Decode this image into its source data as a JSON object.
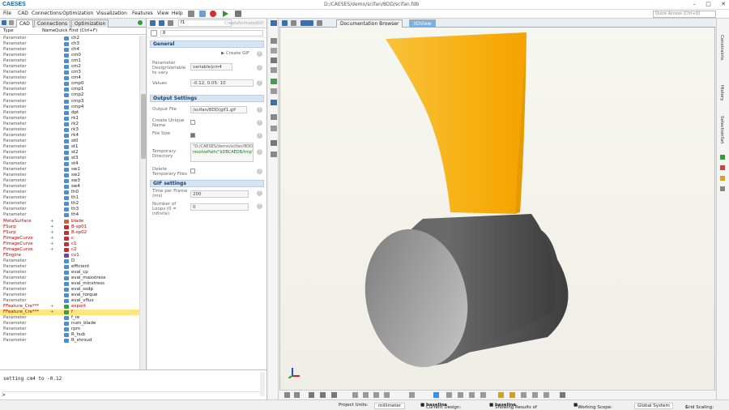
{
  "window": {
    "logo": "CAESES",
    "title": "D:/CAESES/demo/scifan/8DD/scifan.fdb",
    "controls": [
      "–",
      "□",
      "✕"
    ]
  },
  "menu": [
    "File",
    "CAD",
    "Connections",
    "Optimization",
    "Visualization",
    "Features",
    "View",
    "Help"
  ],
  "search_placeholder": "Quick Access (Ctrl+Q)",
  "left_tabs": [
    "CAD",
    "Connections",
    "Optimization"
  ],
  "tree_headers": [
    "Type",
    "Name",
    "Quick Find (Ctrl+F)"
  ],
  "tree": [
    {
      "t": "Parameter",
      "n": "ch2",
      "c": "#4a8fd6"
    },
    {
      "t": "Parameter",
      "n": "ch3",
      "c": "#4a8fd6"
    },
    {
      "t": "Parameter",
      "n": "ch4",
      "c": "#4a8fd6"
    },
    {
      "t": "Parameter",
      "n": "cm0",
      "c": "#4a8fd6"
    },
    {
      "t": "Parameter",
      "n": "cm1",
      "c": "#4a8fd6"
    },
    {
      "t": "Parameter",
      "n": "cm2",
      "c": "#4a8fd6"
    },
    {
      "t": "Parameter",
      "n": "cm3",
      "c": "#4a8fd6"
    },
    {
      "t": "Parameter",
      "n": "cm4",
      "c": "#4a8fd6"
    },
    {
      "t": "Parameter",
      "n": "cmp0",
      "c": "#4a8fd6"
    },
    {
      "t": "Parameter",
      "n": "cmp1",
      "c": "#4a8fd6"
    },
    {
      "t": "Parameter",
      "n": "cmp2",
      "c": "#4a8fd6"
    },
    {
      "t": "Parameter",
      "n": "cmp3",
      "c": "#4a8fd6"
    },
    {
      "t": "Parameter",
      "n": "cmp4",
      "c": "#4a8fd6"
    },
    {
      "t": "Parameter",
      "n": "dpt",
      "c": "#4a8fd6"
    },
    {
      "t": "Parameter",
      "n": "rk1",
      "c": "#4a8fd6"
    },
    {
      "t": "Parameter",
      "n": "rk2",
      "c": "#4a8fd6"
    },
    {
      "t": "Parameter",
      "n": "rk3",
      "c": "#4a8fd6"
    },
    {
      "t": "Parameter",
      "n": "rk4",
      "c": "#4a8fd6"
    },
    {
      "t": "Parameter",
      "n": "st0",
      "c": "#4a8fd6"
    },
    {
      "t": "Parameter",
      "n": "st1",
      "c": "#4a8fd6"
    },
    {
      "t": "Parameter",
      "n": "st2",
      "c": "#4a8fd6"
    },
    {
      "t": "Parameter",
      "n": "st3",
      "c": "#4a8fd6"
    },
    {
      "t": "Parameter",
      "n": "st4",
      "c": "#4a8fd6"
    },
    {
      "t": "Parameter",
      "n": "sw1",
      "c": "#4a8fd6"
    },
    {
      "t": "Parameter",
      "n": "sw2",
      "c": "#4a8fd6"
    },
    {
      "t": "Parameter",
      "n": "sw3",
      "c": "#4a8fd6"
    },
    {
      "t": "Parameter",
      "n": "sw4",
      "c": "#4a8fd6"
    },
    {
      "t": "Parameter",
      "n": "th0",
      "c": "#4a8fd6"
    },
    {
      "t": "Parameter",
      "n": "th1",
      "c": "#4a8fd6"
    },
    {
      "t": "Parameter",
      "n": "th2",
      "c": "#4a8fd6"
    },
    {
      "t": "Parameter",
      "n": "th3",
      "c": "#4a8fd6"
    },
    {
      "t": "Parameter",
      "n": "th4",
      "c": "#4a8fd6"
    },
    {
      "t": "MetaSurface",
      "n": "blade",
      "c": "#d06030",
      "red": true,
      "exp": "+"
    },
    {
      "t": "FSurp",
      "n": "B-sp01",
      "c": "#c03030",
      "red": true,
      "exp": "+"
    },
    {
      "t": "FSurp",
      "n": "B-sp02",
      "c": "#c03030",
      "red": true,
      "exp": "+"
    },
    {
      "t": "FImageCurve",
      "n": "c",
      "c": "#c03030",
      "red": true,
      "exp": "+"
    },
    {
      "t": "FImageCurve",
      "n": "c1",
      "c": "#c03030",
      "red": true,
      "exp": "+"
    },
    {
      "t": "FImageCurve",
      "n": "c2",
      "c": "#c03030",
      "red": true,
      "exp": "+"
    },
    {
      "t": "FEngine",
      "n": "cv1",
      "c": "#8040a0",
      "red": true
    },
    {
      "t": "Parameter",
      "n": "D",
      "c": "#4a8fd6"
    },
    {
      "t": "Parameter",
      "n": "efficient",
      "c": "#4a8fd6"
    },
    {
      "t": "Parameter",
      "n": "eval_cp",
      "c": "#4a8fd6"
    },
    {
      "t": "Parameter",
      "n": "eval_maxstress",
      "c": "#4a8fd6"
    },
    {
      "t": "Parameter",
      "n": "eval_minstress",
      "c": "#4a8fd6"
    },
    {
      "t": "Parameter",
      "n": "eval_ssdp",
      "c": "#4a8fd6"
    },
    {
      "t": "Parameter",
      "n": "eval_torque",
      "c": "#4a8fd6"
    },
    {
      "t": "Parameter",
      "n": "eval_vflux",
      "c": "#4a8fd6"
    },
    {
      "t": "FFeature_Cre***",
      "n": "export",
      "c": "#30a050",
      "red": true,
      "exp": "+"
    },
    {
      "t": "FFeature_Cre***",
      "n": "f",
      "c": "#30a050",
      "red": true,
      "exp": "+",
      "sel": true
    },
    {
      "t": "Parameter",
      "n": "f_re",
      "c": "#4a8fd6"
    },
    {
      "t": "Parameter",
      "n": "num_blade",
      "c": "#4a8fd6"
    },
    {
      "t": "Parameter",
      "n": "rpm",
      "c": "#4a8fd6"
    },
    {
      "t": "Parameter",
      "n": "R_hub",
      "c": "#4a8fd6"
    },
    {
      "t": "Parameter",
      "n": "R_shroud",
      "c": "#4a8fd6"
    }
  ],
  "mid": {
    "object_name": "f1",
    "hint": "CreateAnimatedGif",
    "filter_value": "8",
    "section_general": "General",
    "create_gif_label": "Create GIF",
    "param_label": "Parameter DesignVariable to vary",
    "param_value": "variable|cm4",
    "values_label": "Values",
    "values_value": "-0.12, 0.05: 10",
    "section_output": "Output Settings",
    "output_file_label": "Output File",
    "output_file_value": "/scifan/8DD/gif1.gif",
    "unique_label": "Create Unique Name",
    "file_size_label": "File Size",
    "temp_dir_label": "Temporary Directory",
    "temp_dir_value": "\"D:/CAESES/demo/scifan/8DD",
    "temp_dir_value2": "resolvePath(\"$DBCAEDB/tmp\")",
    "delete_label": "Delete Temporary Files",
    "section_gif": "GIF settings",
    "time_label": "Time per Frame (ms)",
    "time_value": "200",
    "loops_label": "Number of Loops (0 = infinite)",
    "loops_value": "0"
  },
  "viewport_tabs": [
    "Documentation Browser",
    "3DView"
  ],
  "right_tabs": [
    "Constraints",
    "History",
    "SelectionSet"
  ],
  "console_line": "setting cm4 to -0.12",
  "console_prompt": ">",
  "status": {
    "units_label": "Project Units:",
    "units_value": "millimeter",
    "design_label": "Current Design:",
    "design_value": "baseline",
    "showing": "Showing Results of",
    "showing_value": "baseline",
    "scope_label": "Working Scope:",
    "coord_value": "Global System",
    "grid_label": "Grid Scaling:",
    "grid_value": "1"
  },
  "colors": {
    "blade": "#f7b818",
    "hub": "#555555",
    "accent": "#1a5fa8"
  }
}
